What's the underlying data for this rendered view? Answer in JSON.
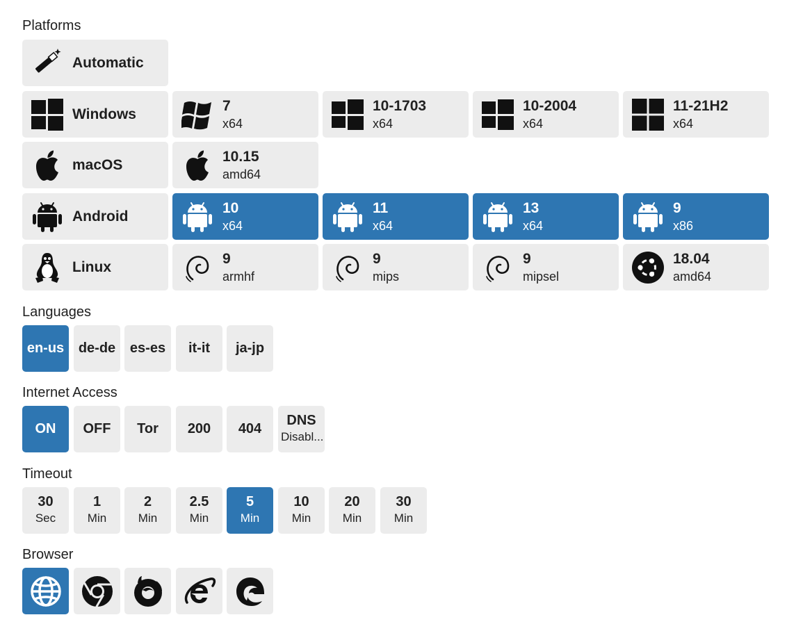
{
  "platforms": {
    "label": "Platforms",
    "automatic": "Automatic",
    "windows": {
      "label": "Windows",
      "versions": [
        {
          "version": "7",
          "arch": "x64"
        },
        {
          "version": "10-1703",
          "arch": "x64"
        },
        {
          "version": "10-2004",
          "arch": "x64"
        },
        {
          "version": "11-21H2",
          "arch": "x64"
        }
      ]
    },
    "macos": {
      "label": "macOS",
      "versions": [
        {
          "version": "10.15",
          "arch": "amd64"
        }
      ]
    },
    "android": {
      "label": "Android",
      "versions": [
        {
          "version": "10",
          "arch": "x64"
        },
        {
          "version": "11",
          "arch": "x64"
        },
        {
          "version": "13",
          "arch": "x64"
        },
        {
          "version": "9",
          "arch": "x86"
        }
      ]
    },
    "linux": {
      "label": "Linux",
      "versions": [
        {
          "version": "9",
          "arch": "armhf",
          "icon": "debian-icon"
        },
        {
          "version": "9",
          "arch": "mips",
          "icon": "debian-icon"
        },
        {
          "version": "9",
          "arch": "mipsel",
          "icon": "debian-icon"
        },
        {
          "version": "18.04",
          "arch": "amd64",
          "icon": "ubuntu-icon"
        }
      ]
    }
  },
  "languages": {
    "label": "Languages",
    "options": [
      "en-us",
      "de-de",
      "es-es",
      "it-it",
      "ja-jp"
    ],
    "selected": "en-us"
  },
  "internet": {
    "label": "Internet Access",
    "options": [
      "ON",
      "OFF",
      "Tor",
      "200",
      "404"
    ],
    "dns": {
      "line1": "DNS",
      "line2": "Disabl..."
    },
    "selected": "ON"
  },
  "timeout": {
    "label": "Timeout",
    "options": [
      {
        "value": "30",
        "unit": "Sec"
      },
      {
        "value": "1",
        "unit": "Min"
      },
      {
        "value": "2",
        "unit": "Min"
      },
      {
        "value": "2.5",
        "unit": "Min"
      },
      {
        "value": "5",
        "unit": "Min"
      },
      {
        "value": "10",
        "unit": "Min"
      },
      {
        "value": "20",
        "unit": "Min"
      },
      {
        "value": "30",
        "unit": "Min"
      }
    ],
    "selected": "5"
  },
  "browser": {
    "label": "Browser",
    "options": [
      "globe-icon",
      "chrome-icon",
      "firefox-icon",
      "internet-explorer-icon",
      "edge-icon"
    ],
    "selected": "globe-icon"
  },
  "colors": {
    "accent": "#2e76b2",
    "tile": "#ececec"
  }
}
